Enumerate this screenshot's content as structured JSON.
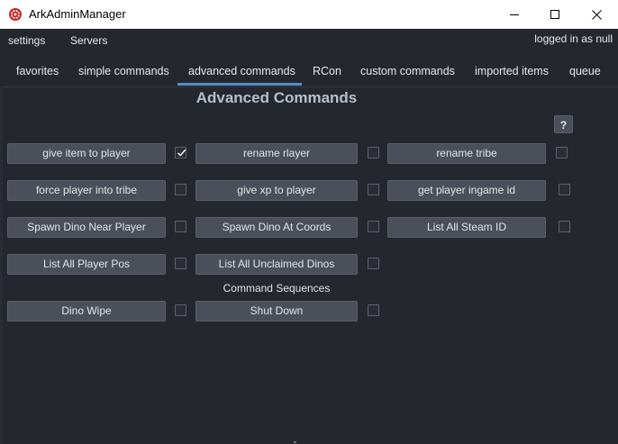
{
  "window": {
    "title": "ArkAdminManager",
    "controls": {
      "minimize": "minimize-icon",
      "maximize": "maximize-icon",
      "close": "close-icon"
    }
  },
  "menu": {
    "items": [
      "settings",
      "Servers"
    ],
    "login_status": "logged in as null"
  },
  "tabs": [
    {
      "label": "favorites",
      "active": false
    },
    {
      "label": "simple commands",
      "active": false
    },
    {
      "label": "advanced commands",
      "active": true
    },
    {
      "label": "RCon",
      "active": false
    },
    {
      "label": "custom commands",
      "active": false
    },
    {
      "label": "imported items",
      "active": false
    },
    {
      "label": "queue",
      "active": false
    }
  ],
  "page": {
    "title": "Advanced Commands",
    "help_label": "?"
  },
  "commands": [
    {
      "label": "give item to player",
      "checked": true
    },
    {
      "label": "rename rlayer",
      "checked": false
    },
    {
      "label": "rename tribe",
      "checked": false
    },
    {
      "label": "force player into tribe",
      "checked": false
    },
    {
      "label": "give xp to player",
      "checked": false
    },
    {
      "label": "get player ingame id",
      "checked": false
    },
    {
      "label": "Spawn Dino Near Player",
      "checked": false
    },
    {
      "label": "Spawn Dino At Coords",
      "checked": false
    },
    {
      "label": "List All Steam ID",
      "checked": false
    },
    {
      "label": "List All Player Pos",
      "checked": false
    },
    {
      "label": "List All Unclaimed Dinos",
      "checked": false
    }
  ],
  "sequences": {
    "label": "Command Sequences",
    "items": [
      {
        "label": "Dino Wipe",
        "checked": false
      },
      {
        "label": "Shut Down",
        "checked": false
      }
    ]
  },
  "colors": {
    "background": "#24272e",
    "button": "#4b4f59",
    "active_tab_underline": "#4a90d9",
    "title_text": "#b7c0ce"
  }
}
